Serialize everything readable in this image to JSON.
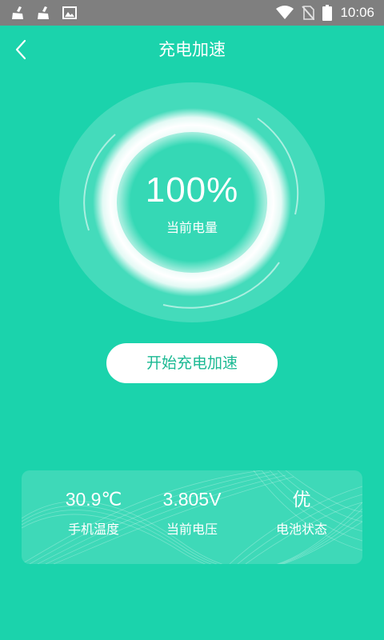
{
  "status_bar": {
    "time": "10:06",
    "icons_left": [
      "broom-icon",
      "broom-icon",
      "image-icon"
    ],
    "icons_right": [
      "wifi-icon",
      "no-sim-icon",
      "battery-icon"
    ]
  },
  "header": {
    "title": "充电加速",
    "back_icon": "chevron-left-icon"
  },
  "gauge": {
    "percent_text": "100%",
    "label": "当前电量",
    "level": 1.0
  },
  "action": {
    "start_label": "开始充电加速"
  },
  "stats": [
    {
      "value": "30.9℃",
      "label": "手机温度"
    },
    {
      "value": "3.805V",
      "label": "当前电压"
    },
    {
      "value": "优",
      "label": "电池状态"
    }
  ],
  "colors": {
    "background": "#1bd3ac",
    "button_text": "#1bb993",
    "status_bar": "#7f7f7f"
  }
}
